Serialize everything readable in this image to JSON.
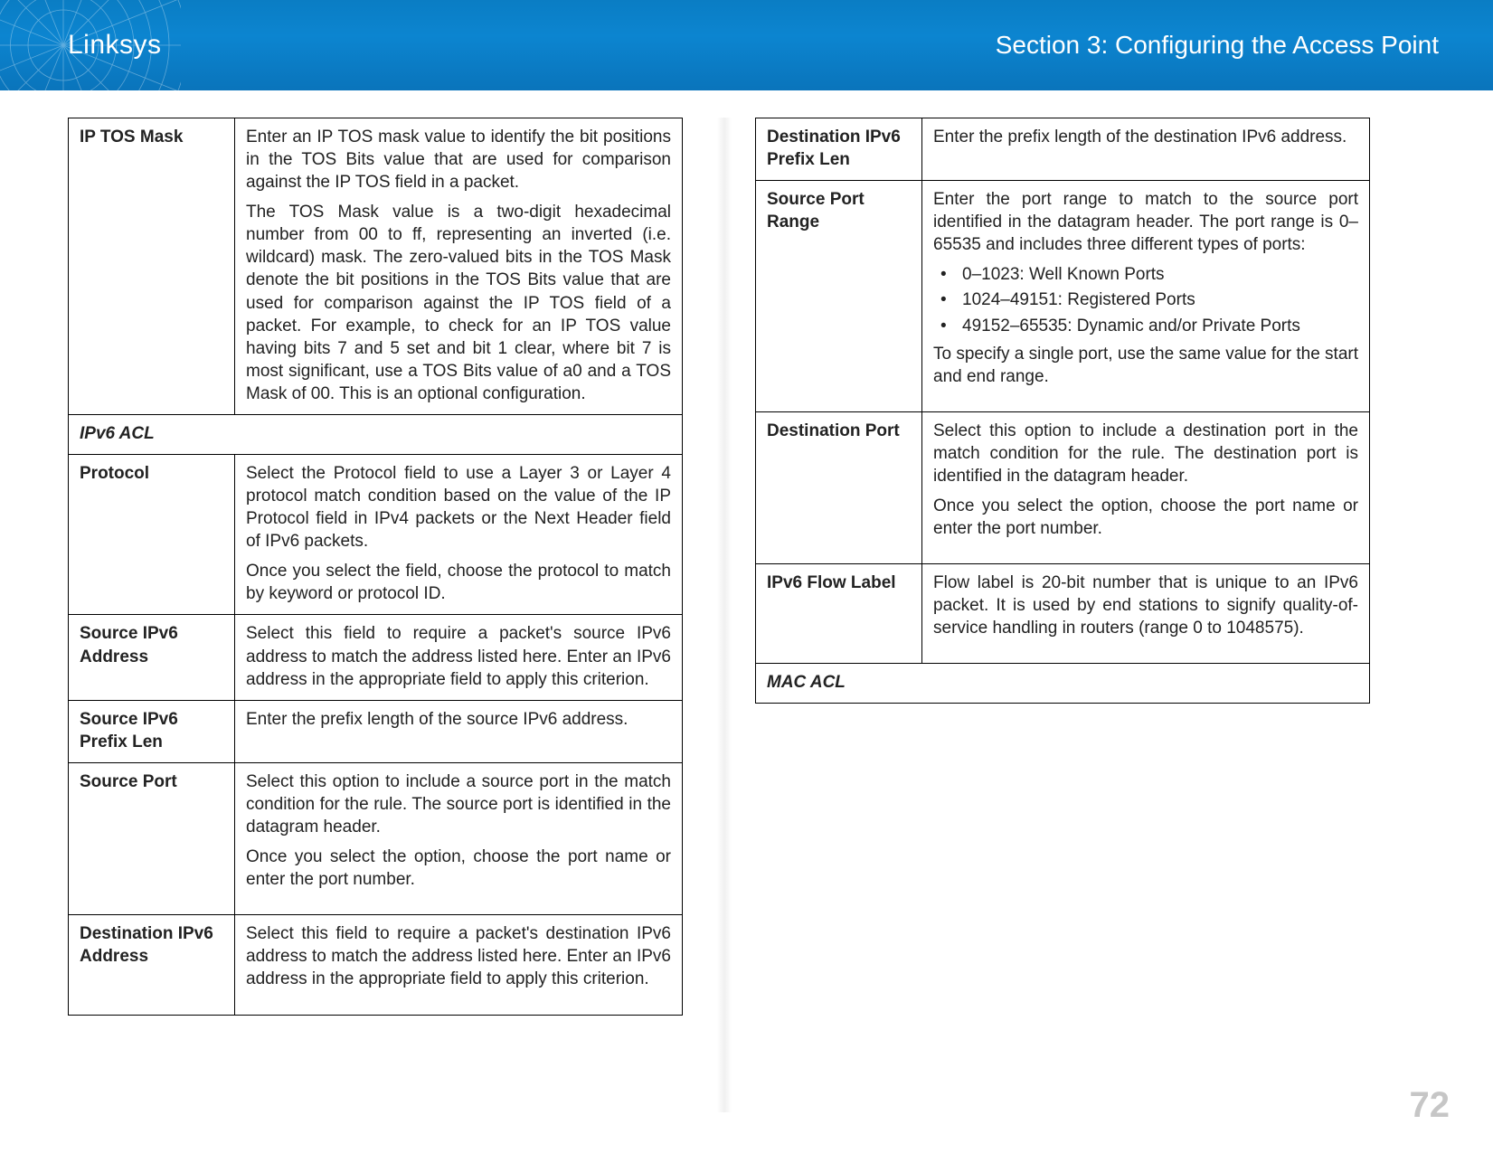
{
  "header": {
    "brand": "Linksys",
    "section": "Section 3:  Configuring the Access Point"
  },
  "page_number": "72",
  "left_table": [
    {
      "type": "row",
      "label": "IP TOS Mask",
      "paragraphs": [
        "Enter an IP TOS mask value to identify the bit positions in the TOS Bits value that are used for comparison against the IP TOS field in a packet.",
        "The TOS Mask value is a two-digit hexadecimal number from 00 to ff, representing an inverted (i.e. wildcard) mask. The zero-valued bits in the TOS Mask denote the bit positions in the TOS Bits value that are used for comparison against the IP TOS field of a packet. For example, to check for an IP TOS value having bits 7 and 5 set and bit 1 clear, where bit 7 is most significant, use a TOS Bits value of a0 and a TOS Mask of 00. This is an optional configuration."
      ]
    },
    {
      "type": "section",
      "label": "IPv6 ACL"
    },
    {
      "type": "row",
      "label": "Protocol",
      "paragraphs": [
        "Select the Protocol field to use a Layer 3 or Layer 4 protocol match condition based on the value of the IP Protocol field in IPv4 packets or the Next Header field of IPv6 packets.",
        "Once you select the field, choose the protocol to match by keyword or protocol ID."
      ]
    },
    {
      "type": "row",
      "label": "Source IPv6 Address",
      "paragraphs": [
        "Select this field to require a packet's source IPv6 address to match the address listed here. Enter an IPv6 address in the appropriate field to apply this criterion."
      ]
    },
    {
      "type": "row",
      "label": "Source IPv6 Prefix Len",
      "paragraphs": [
        "Enter the prefix length of the source IPv6 address."
      ]
    },
    {
      "type": "row",
      "label": "Source Port",
      "paragraphs": [
        "Select this option to include a source port in the match condition for the rule. The source port is identified in the datagram header.",
        "Once you select the option, choose the port name or enter the port number."
      ],
      "pad_bottom": true
    },
    {
      "type": "row",
      "label": "Destination IPv6 Address",
      "paragraphs": [
        "Select this field to require a packet's destination IPv6 address to match the address listed here. Enter an IPv6 address in the appropriate field to apply this criterion."
      ],
      "pad_bottom": true
    }
  ],
  "right_table": [
    {
      "type": "row",
      "label": "Destination IPv6 Prefix Len",
      "paragraphs": [
        "Enter the prefix length of the destination IPv6 address."
      ]
    },
    {
      "type": "row",
      "label": "Source Port Range",
      "paragraphs_before": [
        "Enter the port range to match to the source port identified in the datagram header. The port range is 0–65535 and includes three different types of ports:"
      ],
      "bullets": [
        "0–1023: Well Known Ports",
        "1024–49151: Registered Ports",
        "49152–65535: Dynamic and/or Private Ports"
      ],
      "paragraphs_after": [
        "To specify a single port, use the same value for the start and end range."
      ],
      "pad_bottom": true
    },
    {
      "type": "row",
      "label": "Destination Port",
      "paragraphs": [
        "Select this option to include a destination port in the match condition for the rule. The destination port is identified in the datagram header.",
        "Once you select the option, choose the port name or enter the port number."
      ],
      "pad_bottom": true
    },
    {
      "type": "row",
      "label": "IPv6 Flow Label",
      "paragraphs": [
        "Flow label is 20-bit number that is unique to an IPv6 packet. It is used by end stations to signify quality-of-service handling in routers (range 0 to 1048575)."
      ],
      "pad_bottom": true
    },
    {
      "type": "section",
      "label": "MAC ACL"
    }
  ]
}
